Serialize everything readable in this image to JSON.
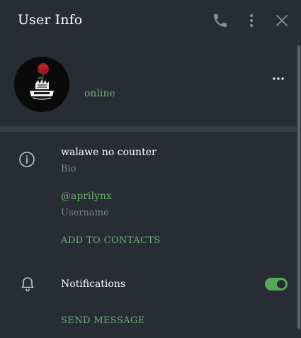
{
  "header": {
    "title": "User Info",
    "icons": [
      "phone-icon",
      "more-vertical-icon",
      "close-icon"
    ]
  },
  "profile": {
    "status": "online",
    "menu_icon": "more-horizontal-icon"
  },
  "details": {
    "bio_value": "walawe no counter",
    "bio_label": "Bio",
    "username_value": "@aprilynx",
    "username_label": "Username",
    "add_to_contacts": "ADD TO CONTACTS"
  },
  "notifications": {
    "label": "Notifications",
    "enabled": true,
    "send_message": "SEND MESSAGE"
  },
  "colors": {
    "panel_bg": "#272c35",
    "accent_green": "#6ab36e",
    "toggle_on": "#57a95a",
    "muted_text": "#7c828a"
  }
}
